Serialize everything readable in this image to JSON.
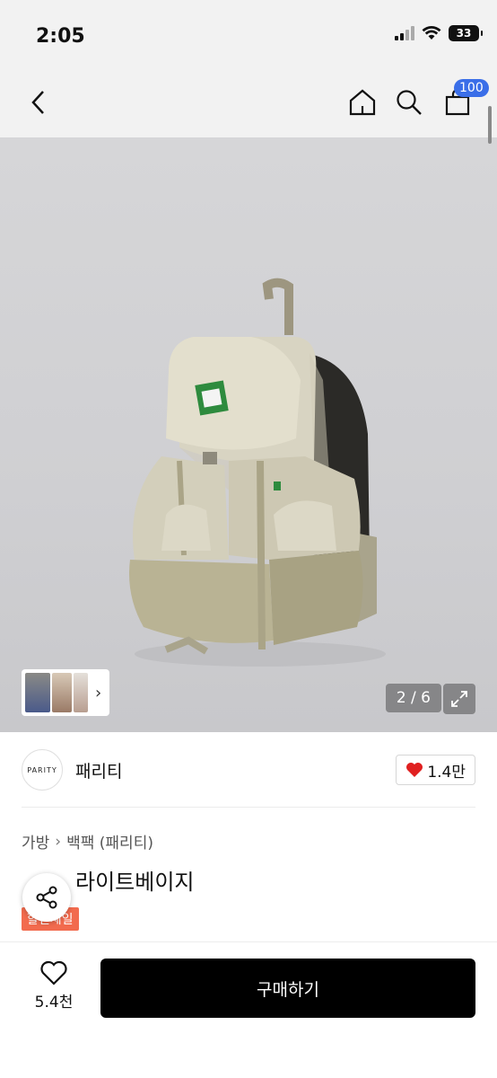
{
  "status": {
    "time": "2:05",
    "battery": "33"
  },
  "nav": {
    "cart_count": "100"
  },
  "gallery": {
    "counter": "2 / 6"
  },
  "shop": {
    "logo_text": "PARITY",
    "name": "패리티",
    "likes": "1.4만"
  },
  "product": {
    "breadcrumb": [
      "가방",
      "백팩 (패리티)"
    ],
    "title": "라이트베이지",
    "tag": "할인세일"
  },
  "bottom": {
    "wish_count": "5.4천",
    "buy_label": "구매하기"
  },
  "colors": {
    "accent_blue": "#3a6ee8",
    "sale": "#f26b4e",
    "heart": "#e02020",
    "buy": "#000000"
  }
}
